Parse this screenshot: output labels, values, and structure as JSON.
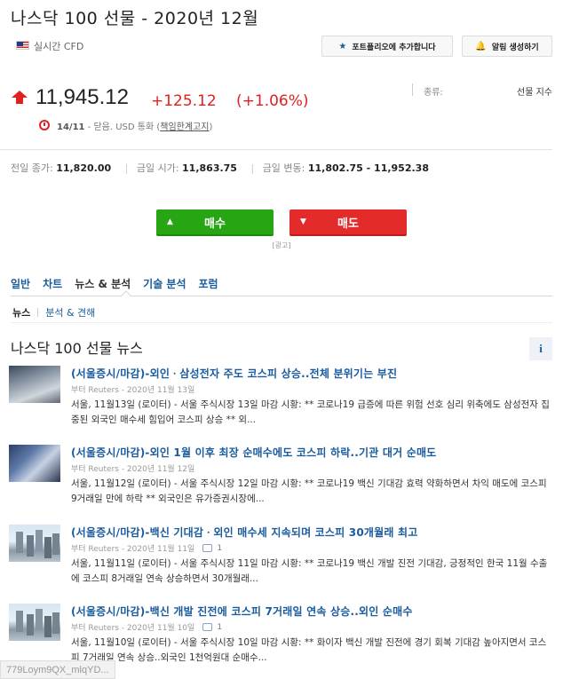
{
  "header": {
    "title": "나스닥 100 선물 - 2020년 12월",
    "realtime_label": "실시간 CFD",
    "portfolio_button": "포트폴리오에 추가합니다",
    "alert_button": "알림 생성하기"
  },
  "quote": {
    "price": "11,945.12",
    "change": "+125.12",
    "change_pct": "(+1.06%)",
    "type_label": "종류:",
    "type_value": "선물 지수",
    "status_date": "14/11",
    "status_text": "- 닫음. USD 통화 (",
    "disclaimer_link": "책임한계고지",
    "status_close": ")"
  },
  "stats": {
    "prev_close_label": "전일 종가:",
    "prev_close": "11,820.00",
    "open_label": "금일 시가:",
    "open": "11,863.75",
    "range_label": "금일 변동:",
    "range": "11,802.75 - 11,952.38"
  },
  "trade": {
    "buy": "매수",
    "sell": "매도",
    "ad_label": "[광고]"
  },
  "tabs": [
    "일반",
    "차트",
    "뉴스 & 분석",
    "기술 분석",
    "포럼"
  ],
  "subtabs": {
    "news": "뉴스",
    "analysis": "분석 & 견해"
  },
  "news": {
    "section_title": "나스닥 100 선물 뉴스",
    "info_icon": "i",
    "items": [
      {
        "headline": "(서울증시/마감)-외인ㆍ삼성전자 주도 코스피 상승..전체 분위기는 부진",
        "byline": "부터 Reuters - 2020년 11월 13일",
        "comments": "",
        "summary": "서울, 11월13일 (로이터) - 서울 주식시장 13일 마감 시황: ** 코로나19 급증에 따른 위험 선호 심리 위축에도 삼성전자 집중된 외국인 매수세 힘입어 코스피 상승 ** 외..."
      },
      {
        "headline": "(서울증시/마감)-외인 1월 이후 최장 순매수에도 코스피 하락..기관 대거 순매도",
        "byline": "부터 Reuters - 2020년 11월 12일",
        "comments": "",
        "summary": "서울, 11월12일 (로이터) - 서울 주식시장 12일 마감 시황: ** 코로나19 백신 기대감 효력 약화하면서 차익 매도에 코스피 9거래일 만에 하락 ** 외국인은 유가증권시장에..."
      },
      {
        "headline": "(서울증시/마감)-백신 기대감ㆍ외인 매수세 지속되며 코스피 30개월래 최고",
        "byline": "부터 Reuters - 2020년 11월 11일",
        "comments": "1",
        "summary": "서울, 11월11일 (로이터) - 서울 주식시장 11일 마감 시황: ** 코로나19 백신 개발 진전 기대감, 긍정적인 한국 11월 수출에 코스피 8거래일 연속 상승하면서 30개월래..."
      },
      {
        "headline": "(서울증시/마감)-백신 개발 진전에 코스피 7거래일 연속 상승..외인 순매수",
        "byline": "부터 Reuters - 2020년 11월 10일",
        "comments": "1",
        "summary": "서울, 11월10일 (로이터) - 서울 주식시장 10일 마감 시황: ** 화이자 백신 개발 진전에 경기 회복 기대감 높아지면서 코스피 7거래일 연속 상승..외국인 1천억원대 순매수..."
      }
    ]
  },
  "overlay": {
    "url_fragment": "779Loym9QX_mlqYD..."
  }
}
